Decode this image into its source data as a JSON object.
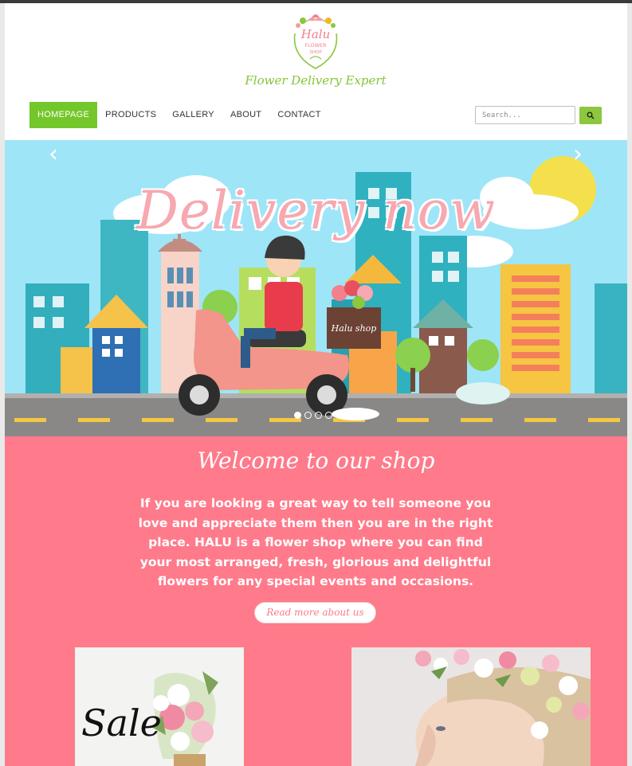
{
  "header": {
    "logo_line1": "Halu",
    "logo_line2": "FLOWER",
    "logo_line3": "SHOP",
    "tagline": "Flower Delivery Expert"
  },
  "nav": {
    "items": [
      "HOMEPAGE",
      "PRODUCTS",
      "GALLERY",
      "ABOUT",
      "CONTACT"
    ],
    "active": "HOMEPAGE"
  },
  "search": {
    "placeholder": "Search...",
    "icon": "search-icon"
  },
  "slider": {
    "title": "Delivery now",
    "box_label": "Halu shop",
    "prev_icon": "chevron-left-icon",
    "next_icon": "chevron-right-icon",
    "prev_glyph": "‹",
    "next_glyph": "›",
    "slide_count": 4,
    "active_slide": 1
  },
  "welcome": {
    "title": "Welcome to our shop",
    "text": "If you are looking a great way to tell someone you love and appreciate them then you are in the right place. HALU is a flower shop where you can find your most arranged, fresh, glorious and delightful flowers for any special events and occasions.",
    "button": "Read more about us"
  },
  "cards": {
    "sale_text": "Sale"
  },
  "colors": {
    "accent_green": "#74c72a",
    "pink": "#ff7a8a",
    "sky": "#9ee5f7"
  }
}
